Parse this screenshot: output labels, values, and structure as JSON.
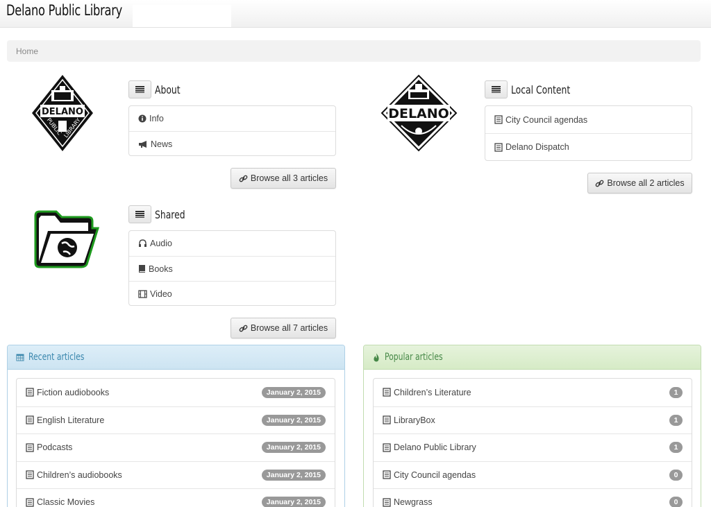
{
  "header": {
    "site_title": "Delano Public Library"
  },
  "breadcrumb": {
    "home": "Home"
  },
  "categories": {
    "about": {
      "logo_text": [
        "DELANO",
        "PUBLIC",
        "LIBRARY"
      ],
      "title": "About",
      "items": [
        {
          "label": "Info",
          "icon": "info-circle-icon"
        },
        {
          "label": "News",
          "icon": "megaphone-icon"
        }
      ],
      "browse_label": "Browse all 3 articles"
    },
    "local": {
      "logo_text": "DELANO",
      "title": "Local Content",
      "items": [
        {
          "label": "City Council agendas",
          "icon": "document-icon"
        },
        {
          "label": "Delano Dispatch",
          "icon": "document-icon"
        }
      ],
      "browse_label": "Browse all 2 articles"
    },
    "shared": {
      "title": "Shared",
      "items": [
        {
          "label": "Audio",
          "icon": "headphones-icon"
        },
        {
          "label": "Books",
          "icon": "book-icon"
        },
        {
          "label": "Video",
          "icon": "film-icon"
        }
      ],
      "browse_label": "Browse all 7 articles"
    }
  },
  "recent": {
    "title": "Recent articles",
    "items": [
      {
        "label": "Fiction audiobooks",
        "date": "January 2, 2015"
      },
      {
        "label": "English Literature",
        "date": "January 2, 2015"
      },
      {
        "label": "Podcasts",
        "date": "January 2, 2015"
      },
      {
        "label": "Children’s audiobooks",
        "date": "January 2, 2015"
      },
      {
        "label": "Classic Movies",
        "date": "January 2, 2015"
      }
    ]
  },
  "popular": {
    "title": "Popular articles",
    "items": [
      {
        "label": "Children’s Literature",
        "count": "1"
      },
      {
        "label": "LibraryBox",
        "count": "1"
      },
      {
        "label": "Delano Public Library",
        "count": "1"
      },
      {
        "label": "City Council agendas",
        "count": "0"
      },
      {
        "label": "Newgrass",
        "count": "0"
      }
    ]
  },
  "colors": {
    "recent_accent": "#3a87ad",
    "popular_accent": "#468847",
    "badge": "#999999",
    "folder_border": "#1e9a1e"
  }
}
